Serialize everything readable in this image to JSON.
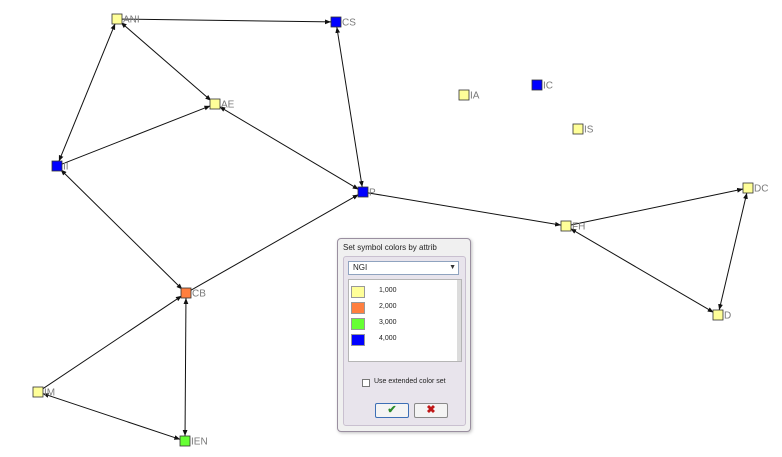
{
  "graph": {
    "nodes": [
      {
        "id": "ANI",
        "color": "#ffff99"
      },
      {
        "id": "CS",
        "color": "#0000ff"
      },
      {
        "id": "AE",
        "color": "#ffff99"
      },
      {
        "id": "II",
        "color": "#0000ff"
      },
      {
        "id": "P",
        "color": "#0000ff"
      },
      {
        "id": "IA",
        "color": "#ffff99"
      },
      {
        "id": "IC",
        "color": "#0000ff"
      },
      {
        "id": "IS",
        "color": "#ffff99"
      },
      {
        "id": "FH",
        "color": "#ffff99"
      },
      {
        "id": "DC",
        "color": "#ffff99"
      },
      {
        "id": "D",
        "color": "#ffff99"
      },
      {
        "id": "CB",
        "color": "#ff7f3f"
      },
      {
        "id": "IM",
        "color": "#ffff99"
      },
      {
        "id": "IEN",
        "color": "#66ff33"
      }
    ],
    "edges": [
      {
        "from": "ANI",
        "to": "CS",
        "bidirectional": false
      },
      {
        "from": "ANI",
        "to": "AE",
        "bidirectional": true
      },
      {
        "from": "ANI",
        "to": "II",
        "bidirectional": true
      },
      {
        "from": "II",
        "to": "AE",
        "bidirectional": false
      },
      {
        "from": "CS",
        "to": "P",
        "bidirectional": true
      },
      {
        "from": "AE",
        "to": "P",
        "bidirectional": true
      },
      {
        "from": "P",
        "to": "FH",
        "bidirectional": false
      },
      {
        "from": "FH",
        "to": "DC",
        "bidirectional": false
      },
      {
        "from": "FH",
        "to": "D",
        "bidirectional": true
      },
      {
        "from": "DC",
        "to": "D",
        "bidirectional": true
      },
      {
        "from": "CB",
        "to": "II",
        "bidirectional": true
      },
      {
        "from": "CB",
        "to": "P",
        "bidirectional": false
      },
      {
        "from": "IM",
        "to": "CB",
        "bidirectional": false
      },
      {
        "from": "IM",
        "to": "IEN",
        "bidirectional": true
      },
      {
        "from": "CB",
        "to": "IEN",
        "bidirectional": true
      }
    ]
  },
  "dialog": {
    "title": "Set symbol colors by attrib",
    "attribute": "NGI",
    "legend": [
      {
        "label": "1,000",
        "color": "#ffff99"
      },
      {
        "label": "2,000",
        "color": "#ff7f3f"
      },
      {
        "label": "3,000",
        "color": "#66ff33"
      },
      {
        "label": "4,000",
        "color": "#0000ff"
      }
    ],
    "extended_label": "Use extended color set",
    "extended_checked": false,
    "ok_icon": "check-icon",
    "cancel_icon": "cross-icon"
  }
}
